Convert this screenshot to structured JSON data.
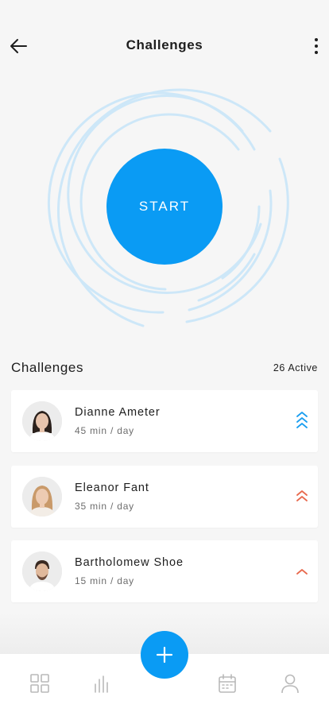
{
  "header": {
    "title": "Challenges"
  },
  "start": {
    "label": "START"
  },
  "section": {
    "title": "Challenges",
    "count": "26 Active"
  },
  "challenges": [
    {
      "name": "Dianne Ameter",
      "duration": "45 min / day",
      "priority": "high",
      "color": "#1a9ef0"
    },
    {
      "name": "Eleanor Fant",
      "duration": "35 min / day",
      "priority": "medium",
      "color": "#e8694d"
    },
    {
      "name": "Bartholomew Shoe",
      "duration": "15 min / day",
      "priority": "low",
      "color": "#e8694d"
    }
  ],
  "colors": {
    "accent": "#0a9bf4",
    "rings": "#cde7f8",
    "background": "#f6f6f6"
  },
  "tabs": [
    "dashboard-icon",
    "stats-icon",
    "calendar-icon",
    "profile-icon"
  ]
}
